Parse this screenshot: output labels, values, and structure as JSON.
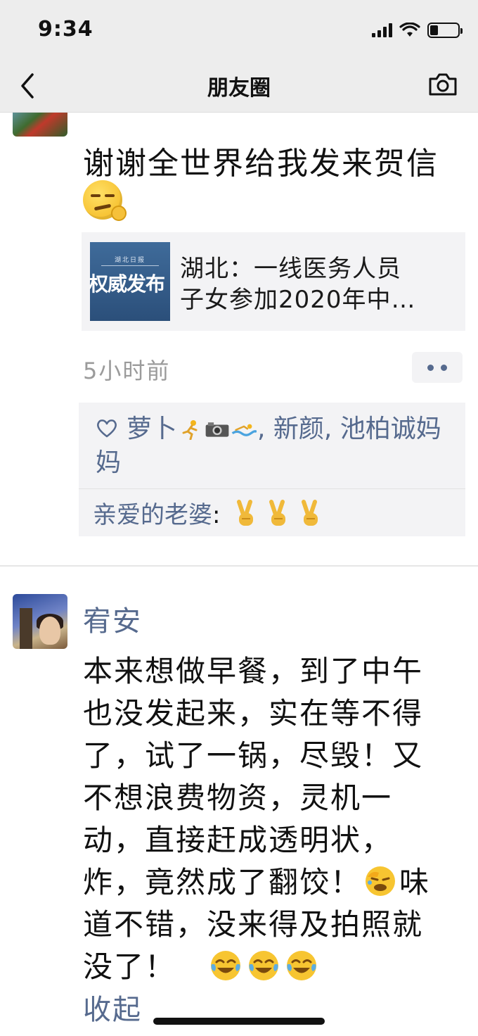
{
  "status_bar": {
    "time": "9:34",
    "battery_level": 0.3
  },
  "nav": {
    "title": "朋友圈",
    "back_icon": "chevron-left-icon",
    "camera_icon": "camera-icon"
  },
  "post1": {
    "text": "谢谢全世界给我发来贺信",
    "link": {
      "thumb_small": "湖北日报",
      "thumb_big": "权威发布",
      "title_line1": "湖北：一线医务人员",
      "title_line2": "子女参加2020年中…"
    },
    "time": "5小时前",
    "likes": {
      "name1": "萝卜",
      "names_rest": ", 新颜, 池柏诚妈妈"
    },
    "comment": {
      "author": "亲爱的老婆",
      "sep": ": "
    }
  },
  "post2": {
    "author": "宥安",
    "lines": [
      "本来想做早餐，到了中午",
      "也没发起来，实在等不得",
      "了，试了一锅，尽毁！又",
      "不想浪费物资，灵机一",
      "动，直接赶成透明状，",
      "炸，竟然成了翻饺！",
      "道不错，没来得及拍照就",
      "没了！"
    ],
    "line6_tail": "味",
    "collapse_label": "收起"
  }
}
